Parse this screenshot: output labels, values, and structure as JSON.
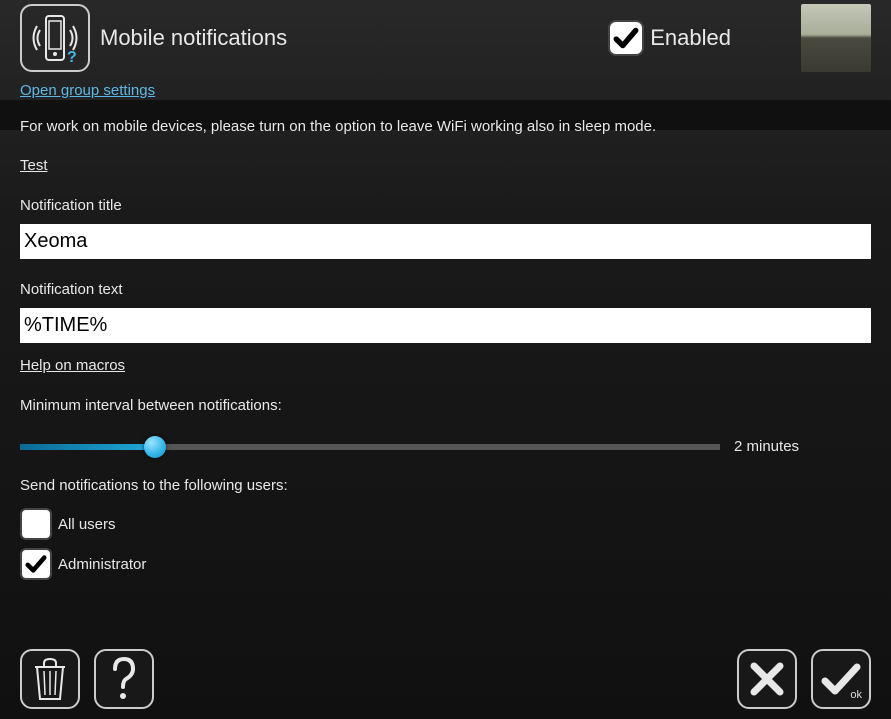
{
  "header": {
    "title": "Mobile notifications",
    "enabled_label": "Enabled",
    "enabled_checked": true
  },
  "links": {
    "group_settings": "Open group settings",
    "test": "Test",
    "help_macros": "Help on macros"
  },
  "info": {
    "wifi_note": "For work on mobile devices, please turn on the option to leave WiFi working also in sleep mode."
  },
  "fields": {
    "title_label": "Notification title",
    "title_value": "Xeoma",
    "text_label": "Notification text",
    "text_value": "%TIME%"
  },
  "interval": {
    "label": "Minimum interval between notifications:",
    "display": "2 minutes",
    "percent": 19.3
  },
  "users": {
    "label": "Send notifications to the following users:",
    "items": [
      {
        "label": "All users",
        "checked": false
      },
      {
        "label": "Administrator",
        "checked": true
      }
    ]
  },
  "footer": {
    "ok_label": "ok"
  }
}
